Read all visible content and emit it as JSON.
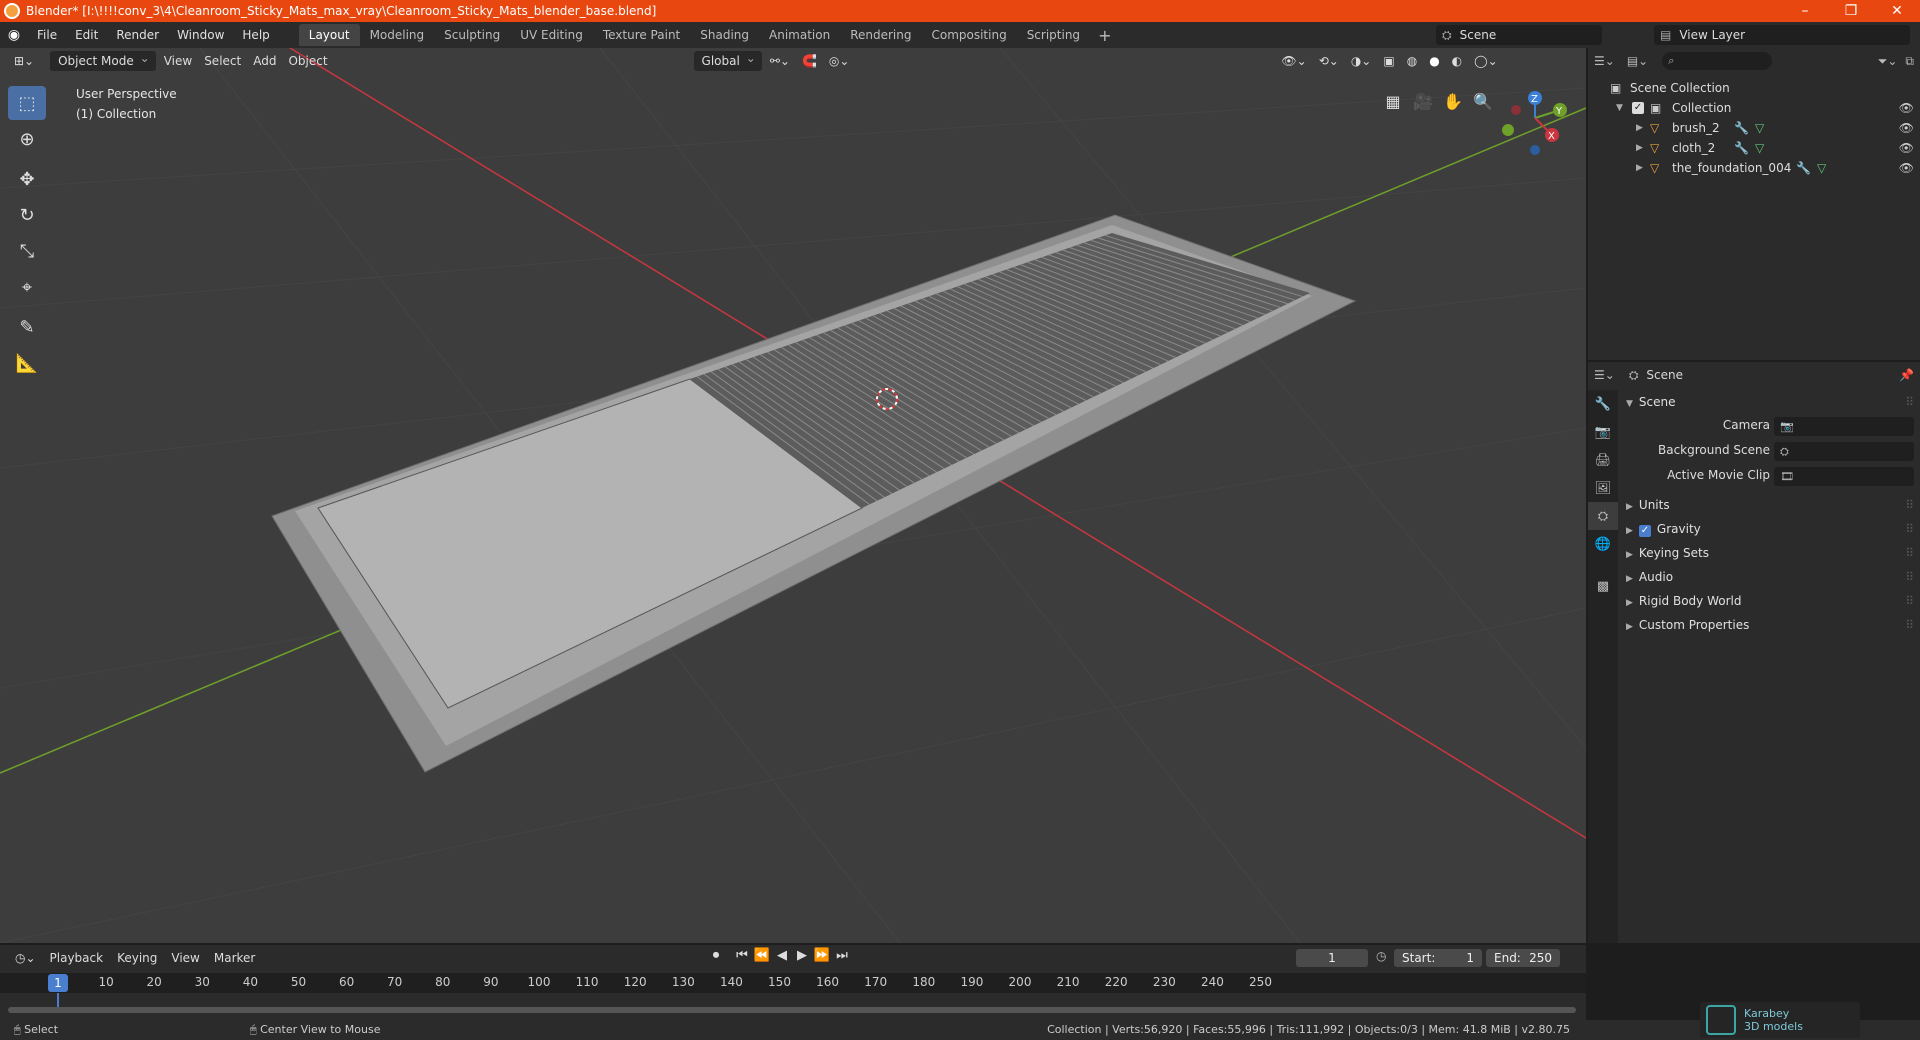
{
  "window": {
    "title": "Blender* [I:\\!!!!conv_3\\4\\Cleanroom_Sticky_Mats_max_vray\\Cleanroom_Sticky_Mats_blender_base.blend]",
    "minimize": "–",
    "maximize": "❐",
    "close": "✕"
  },
  "menu": {
    "items": [
      "File",
      "Edit",
      "Render",
      "Window",
      "Help"
    ]
  },
  "workspaces": {
    "tabs": [
      "Layout",
      "Modeling",
      "Sculpting",
      "UV Editing",
      "Texture Paint",
      "Shading",
      "Animation",
      "Rendering",
      "Compositing",
      "Scripting"
    ],
    "active": "Layout",
    "add": "+"
  },
  "scene_selector": {
    "value": "Scene"
  },
  "view_layer_selector": {
    "value": "View Layer"
  },
  "viewport": {
    "mode": "Object Mode",
    "menus": [
      "View",
      "Select",
      "Add",
      "Object"
    ],
    "transform_orientation": "Global",
    "perspective_label": "User Perspective",
    "collection_label": "(1) Collection",
    "gizmo_axes": [
      "Z",
      "Y",
      "X"
    ]
  },
  "toolbar": {
    "tools": [
      "select-box",
      "cursor",
      "move",
      "rotate",
      "scale",
      "transform",
      "annotate",
      "measure"
    ]
  },
  "outliner": {
    "search_placeholder": "",
    "root": "Scene Collection",
    "collection": "Collection",
    "objects": [
      "brush_2",
      "cloth_2",
      "the_foundation_004"
    ]
  },
  "properties": {
    "context": "Scene",
    "panel_title": "Scene",
    "fields": [
      {
        "label": "Camera",
        "value": ""
      },
      {
        "label": "Background Scene",
        "value": ""
      },
      {
        "label": "Active Movie Clip",
        "value": ""
      }
    ],
    "subpanels": [
      "Units",
      "Gravity",
      "Keying Sets",
      "Audio",
      "Rigid Body World",
      "Custom Properties"
    ],
    "gravity_checked": true
  },
  "timeline": {
    "menus": [
      "Playback",
      "Keying",
      "View",
      "Marker"
    ],
    "current_frame": "1",
    "start_label": "Start:",
    "start": "1",
    "end_label": "End:",
    "end": "250",
    "ticks": [
      "10",
      "20",
      "30",
      "40",
      "50",
      "60",
      "70",
      "80",
      "90",
      "100",
      "110",
      "120",
      "130",
      "140",
      "150",
      "160",
      "170",
      "180",
      "190",
      "200",
      "210",
      "220",
      "230",
      "240",
      "250"
    ],
    "cursor": "1"
  },
  "statusbar": {
    "left": "Select",
    "middle": "Center View to Mouse",
    "right": "Collection | Verts:56,920 | Faces:55,996 | Tris:111,992 | Objects:0/3 | Mem: 41.8 MiB | v2.80.75"
  },
  "watermark": {
    "line1": "Karabey",
    "line2": "3D models"
  },
  "colors": {
    "titlebar": "#e8480f",
    "accent": "#4a7fd0",
    "viewport_bg": "#3d3d3d",
    "panel_bg": "#2b2b2b",
    "x_axis": "#c9363f",
    "y_axis": "#6ea02a",
    "z_axis": "#3b7fd6"
  }
}
